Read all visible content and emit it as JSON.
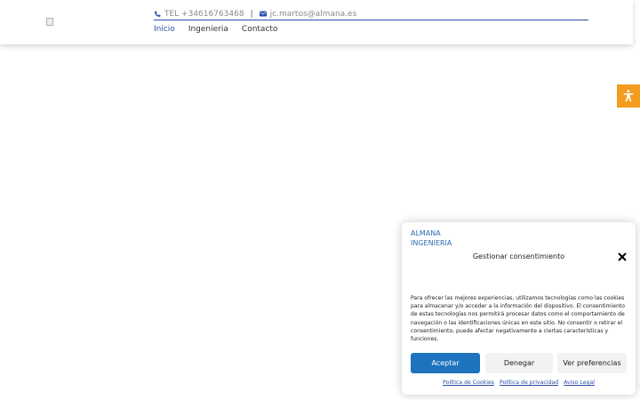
{
  "header": {
    "tel": "TEL +34616763468",
    "separator": "|",
    "email": "jc.martos@almana.es",
    "nav": [
      "Inicio",
      "Ingenieria",
      "Contacto"
    ]
  },
  "cookie_banner": {
    "logo_alt": "ALMANA INGENIERIA",
    "title": "Gestionar consentimiento",
    "body": "Para ofrecer las mejores experiencias, utilizamos tecnologías como las cookies para almacenar y/o acceder a la información del dispositivo. El consentimiento de estas tecnologías nos permitirá procesar datos como el comportamiento de navegación o las identificaciones únicas en este sitio. No consentir o retirar el consentimiento, puede afectar negativamente a ciertas características y funciones.",
    "accept": "Aceptar",
    "deny": "Denegar",
    "prefs": "Ver preferencias",
    "links": [
      "Política de Cookies",
      "Política de privacidad",
      "Aviso Legal"
    ]
  },
  "colors": {
    "accent": "#2b4ea8",
    "accept_button": "#1e73be",
    "accessibility_button": "#f39c1f"
  },
  "icons": [
    "phone-icon",
    "envelope-icon",
    "accessibility-icon",
    "close-icon"
  ]
}
